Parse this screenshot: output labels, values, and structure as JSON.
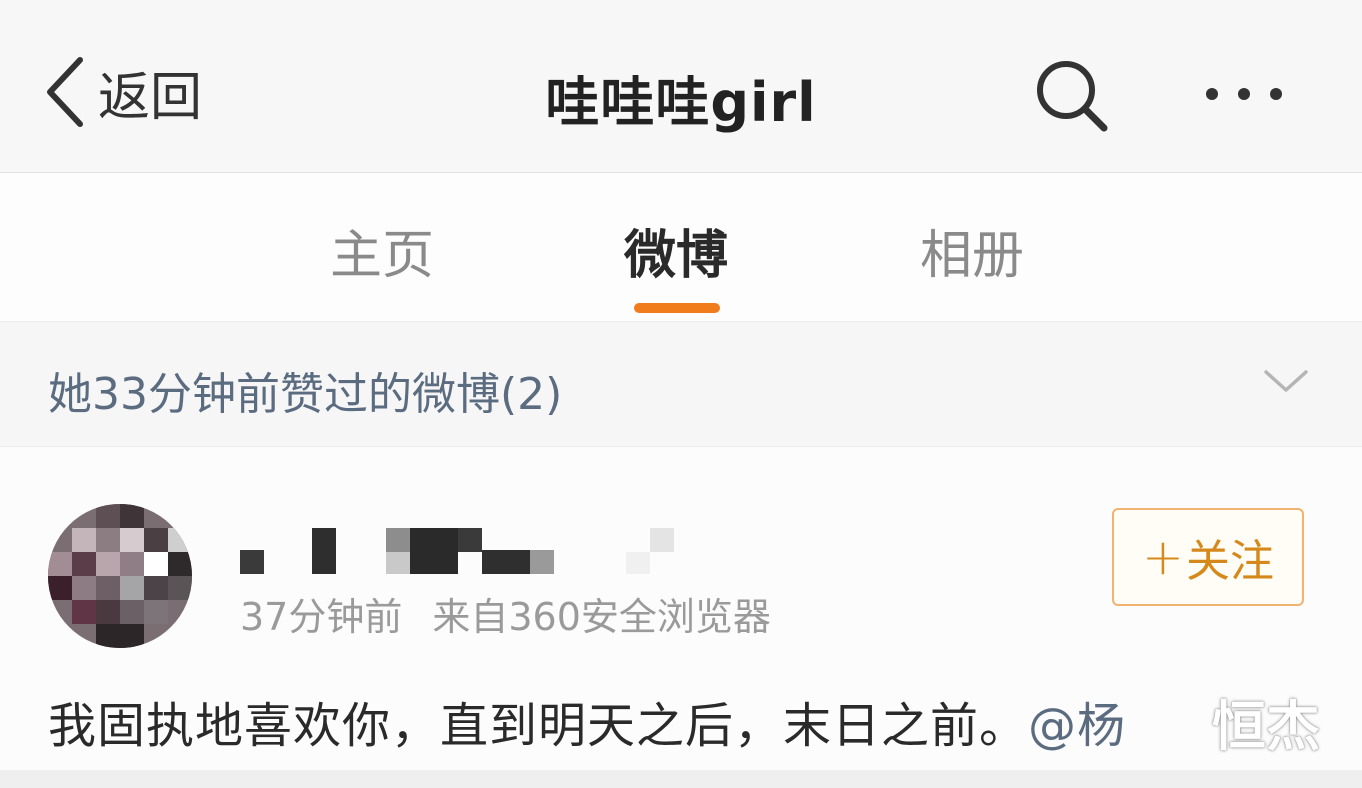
{
  "nav": {
    "back_label": "返回",
    "title": "哇哇哇girl",
    "search_icon": "search-icon",
    "more_icon": "more-icon"
  },
  "tabs": [
    {
      "label": "主页",
      "active": false
    },
    {
      "label": "微博",
      "active": true
    },
    {
      "label": "相册",
      "active": false
    }
  ],
  "liked_section": {
    "label": "她33分钟前赞过的微博(2)",
    "icon": "chevron-down-icon"
  },
  "post": {
    "time": "37分钟前",
    "source": "来自360安全浏览器",
    "follow_plus": "+",
    "follow_label": "关注",
    "text": "我固执地喜欢你，直到明天之后，末日之前。",
    "mention_partial": "@杨"
  },
  "watermark": "恒杰",
  "colors": {
    "accent": "#f07c1c",
    "follow_border": "#f1b36f",
    "follow_text": "#d6891b",
    "link": "#5b6c80"
  }
}
